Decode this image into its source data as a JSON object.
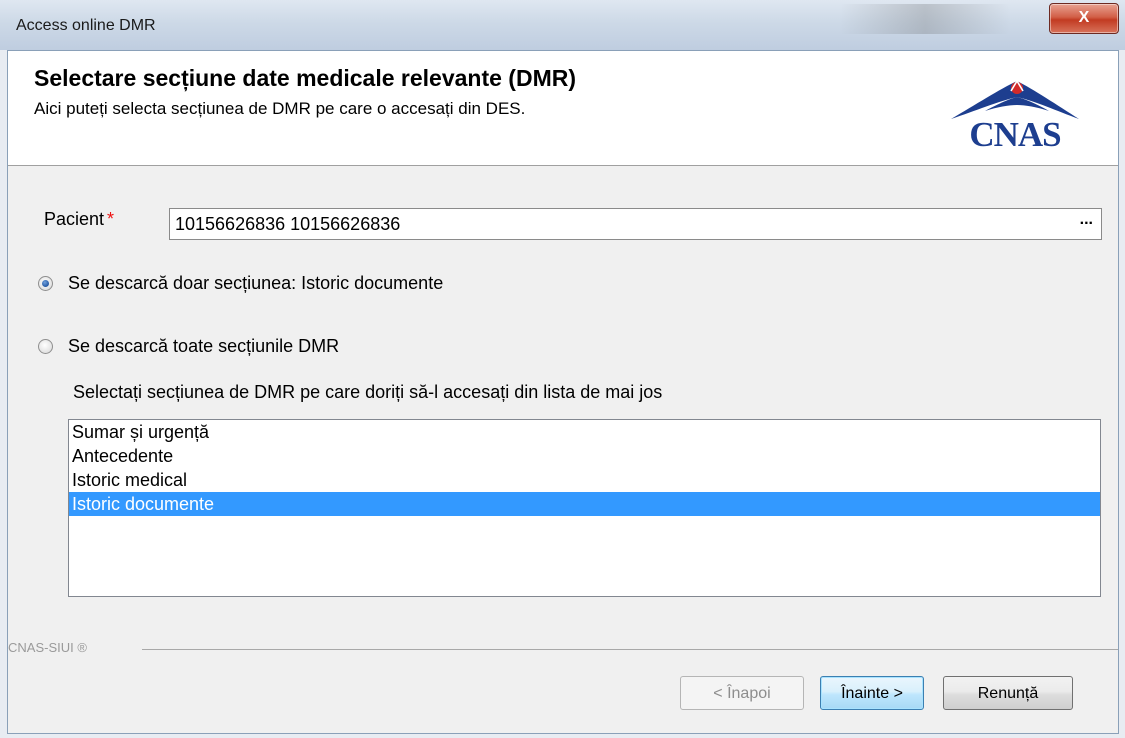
{
  "window": {
    "title": "Access online DMR",
    "close_label": "X"
  },
  "header": {
    "title": "Selectare secțiune date medicale relevante (DMR)",
    "subtitle": "Aici puteți selecta secțiunea de DMR pe care o accesați din DES.",
    "logo_text": "CNAS"
  },
  "form": {
    "patient_label": "Pacient",
    "required_mark": "*",
    "patient_value": "10156626836 10156626836",
    "browse_label": "..."
  },
  "options": [
    {
      "label": "Se descarcă doar secțiunea: Istoric documente",
      "checked": true
    },
    {
      "label": "Se descarcă toate secțiunile DMR",
      "checked": false
    }
  ],
  "list": {
    "caption": "Selectați secțiunea de DMR pe care doriți să-l accesați din lista de mai jos",
    "items": [
      "Sumar și urgență",
      "Antecedente",
      "Istoric medical",
      "Istoric documente"
    ],
    "selected_index": 3
  },
  "footer": {
    "brand": "CNAS-SIUI ®"
  },
  "buttons": {
    "back": "< Înapoi",
    "next": "Înainte >",
    "cancel": "Renunță"
  },
  "colors": {
    "selection": "#3399ff",
    "logo": "#1d3e8f",
    "required": "#ee1111"
  }
}
